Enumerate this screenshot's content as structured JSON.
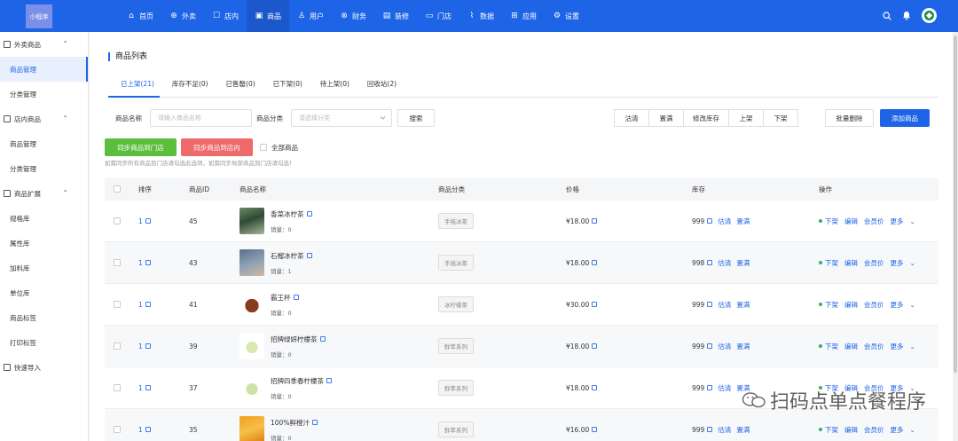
{
  "app": {
    "logo": "小程序"
  },
  "nav": [
    {
      "icon": "home-icon",
      "glyph": "⌂",
      "label": "首页"
    },
    {
      "icon": "takeout-icon",
      "glyph": "⊕",
      "label": "外卖"
    },
    {
      "icon": "store-icon",
      "glyph": "☐",
      "label": "店内"
    },
    {
      "icon": "goods-icon",
      "glyph": "▣",
      "label": "商品"
    },
    {
      "icon": "user-icon",
      "glyph": "♙",
      "label": "用户"
    },
    {
      "icon": "finance-icon",
      "glyph": "⊗",
      "label": "财务"
    },
    {
      "icon": "decorate-icon",
      "glyph": "▤",
      "label": "装修"
    },
    {
      "icon": "shop-icon",
      "glyph": "▭",
      "label": "门店"
    },
    {
      "icon": "data-icon",
      "glyph": "⌇",
      "label": "数据"
    },
    {
      "icon": "apps-icon",
      "glyph": "⊞",
      "label": "应用"
    },
    {
      "icon": "settings-icon",
      "glyph": "⚙",
      "label": "设置"
    }
  ],
  "sidebar": {
    "groups": [
      {
        "label": "外卖商品",
        "items": [
          "商品管理",
          "分类管理"
        ]
      },
      {
        "label": "店内商品",
        "items": [
          "商品管理",
          "分类管理"
        ]
      },
      {
        "label": "商品扩展",
        "items": [
          "规格库",
          "属性库",
          "加料库",
          "单位库",
          "商品标签",
          "打印标签"
        ]
      }
    ],
    "extra": "快速导入"
  },
  "page": {
    "title": "商品列表"
  },
  "tabs": [
    "已上架(21)",
    "库存不足(0)",
    "已售罄(0)",
    "已下架(0)",
    "待上架(0)",
    "回收站(2)"
  ],
  "filter": {
    "name_label": "商品名称",
    "name_placeholder": "请输入商品名称",
    "category_label": "商品分类",
    "category_placeholder": "请选择分类",
    "search": "搜索",
    "actions": [
      "沽清",
      "置满",
      "修改库存",
      "上架",
      "下架"
    ],
    "batch_delete": "批量删除",
    "add": "添加商品",
    "sync_store": "同步商品到门店",
    "sync_inner": "同步商品到店内",
    "all_goods": "全部商品",
    "hint": "如需同步所有商品到门店请勾选此选项，如需同步局部商品到门店请勾选！"
  },
  "table": {
    "headers": [
      "排序",
      "商品ID",
      "商品名称",
      "商品分类",
      "价格",
      "库存",
      "操作"
    ],
    "sales_prefix": "销量：",
    "rows": [
      {
        "sort": "1",
        "id": "45",
        "name": "香菜冰柠茶",
        "sales": "0",
        "category": "手摇冰茶",
        "price": "¥18.00",
        "stock": "999"
      },
      {
        "sort": "1",
        "id": "43",
        "name": "石榴冰柠茶",
        "sales": "1",
        "category": "手摇冰茶",
        "price": "¥18.00",
        "stock": "998"
      },
      {
        "sort": "1",
        "id": "41",
        "name": "霸王杯",
        "sales": "0",
        "category": "冰柠檬茶",
        "price": "¥30.00",
        "stock": "999"
      },
      {
        "sort": "1",
        "id": "39",
        "name": "招牌绿妍柠檬茶",
        "sales": "0",
        "category": "鲜萃系列",
        "price": "¥18.00",
        "stock": "999"
      },
      {
        "sort": "1",
        "id": "37",
        "name": "招牌四季春柠檬茶",
        "sales": "0",
        "category": "鲜萃系列",
        "price": "¥18.00",
        "stock": "999"
      },
      {
        "sort": "1",
        "id": "35",
        "name": "100%鲜橙汁",
        "sales": "0",
        "category": "鲜萃系列",
        "price": "¥16.00",
        "stock": "999"
      }
    ],
    "stock_ops": [
      "估清",
      "置满"
    ],
    "row_ops": [
      "下架",
      "编辑",
      "会员价",
      "更多"
    ]
  },
  "watermark": "扫码点单点餐程序",
  "colors": {
    "primary": "#1d64e6",
    "green": "#5cbe3d",
    "red": "#ef6a6a"
  }
}
